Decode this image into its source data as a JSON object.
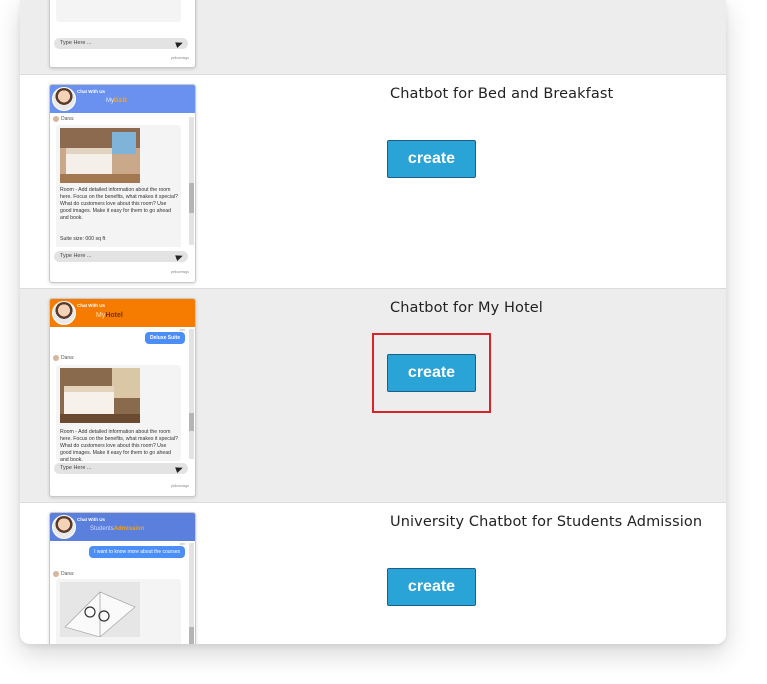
{
  "colors": {
    "create_button": "#2aa3d6",
    "highlight": "#d8242b",
    "bnb_header": "#6a91f0",
    "hotel_header": "#f57c00",
    "uni_header": "#5b7fdc"
  },
  "templates": [
    {
      "title": "",
      "button": "",
      "widget": {
        "input_placeholder": "Type Here ...",
        "powered": "yellowmsgs"
      }
    },
    {
      "title": "Chatbot for Bed and Breakfast",
      "button": "create",
      "widget": {
        "chat_label": "Chat With Us",
        "brand_prefix": "My",
        "brand": "B&B",
        "agent": "Dana:",
        "description": "Room - Add detailed information about the room here. Focus on the benefits, what makes it special? What do customers love about this room? Use good images. Make it easy for them to go ahead and book.",
        "extra": "Suite size: 000 sq ft",
        "input_placeholder": "Type Here ...",
        "powered": "yellowmsgs"
      }
    },
    {
      "title": "Chatbot for My Hotel",
      "button": "create",
      "widget": {
        "chat_label": "Chat With Us",
        "brand_prefix": "My",
        "brand": "Hotel",
        "user_message": "Deluxe Suite",
        "agent": "Dana:",
        "description": "Room - Add detailed information about the room here. Focus on the benefits, what makes it special? What do customers love about this room? Use good images. Make it easy for them to go ahead and book.",
        "input_placeholder": "Type Here ...",
        "powered": "yellowmsgs"
      }
    },
    {
      "title": "University Chatbot for Students Admission",
      "button": "create",
      "widget": {
        "chat_label": "Chat With Us",
        "brand_prefix": "Students",
        "brand": "Admission",
        "user_message": "I want to know more about the courses",
        "agent": "Dana:"
      }
    }
  ]
}
